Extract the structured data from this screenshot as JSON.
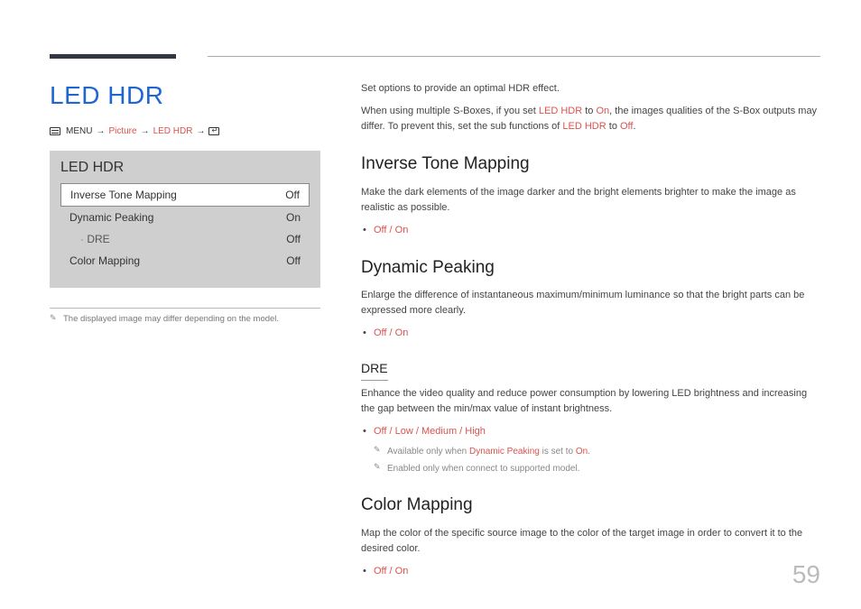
{
  "page_number": "59",
  "title": "LED HDR",
  "breadcrumb": {
    "menu": "MENU",
    "arrow": "→",
    "picture": "Picture",
    "ledhdr": "LED HDR"
  },
  "panel": {
    "title": "LED HDR",
    "rows": [
      {
        "label": "Inverse Tone Mapping",
        "value": "Off",
        "selected": true,
        "sub": false
      },
      {
        "label": "Dynamic Peaking",
        "value": "On",
        "selected": false,
        "sub": false
      },
      {
        "label": "DRE",
        "value": "Off",
        "selected": false,
        "sub": true
      },
      {
        "label": "Color Mapping",
        "value": "Off",
        "selected": false,
        "sub": false
      }
    ]
  },
  "left_note": "The displayed image may differ depending on the model.",
  "intro": {
    "p1": "Set options to provide an optimal HDR effect.",
    "p2a": "When using multiple S-Boxes, if you set ",
    "p2_lh1": "LED HDR",
    "p2b": " to ",
    "p2_on": "On",
    "p2c": ", the images qualities of the S-Box outputs may differ. To prevent this, set the sub functions of ",
    "p2_lh2": "LED HDR",
    "p2d": " to ",
    "p2_off": "Off",
    "p2e": "."
  },
  "sections": {
    "itm": {
      "h": "Inverse Tone Mapping",
      "p": "Make the dark elements of the image darker and the bright elements brighter to make the image as realistic as possible.",
      "opt": "Off / On"
    },
    "dp": {
      "h": "Dynamic Peaking",
      "p": "Enlarge the difference of instantaneous maximum/minimum luminance so that the bright parts can be expressed more clearly.",
      "opt": "Off / On"
    },
    "dre": {
      "h": "DRE",
      "p": "Enhance the video quality and reduce power consumption by lowering LED brightness and increasing the gap between the min/max value of instant brightness.",
      "opt": "Off / Low / Medium / High",
      "n1a": "Available only when ",
      "n1_dp": "Dynamic Peaking",
      "n1b": " is set to ",
      "n1_on": "On",
      "n1c": ".",
      "n2": "Enabled only when connect to supported model."
    },
    "cm": {
      "h": "Color Mapping",
      "p": "Map the color of the specific source image to the color of the target image in order to convert it to the desired color.",
      "opt": "Off / On"
    }
  }
}
